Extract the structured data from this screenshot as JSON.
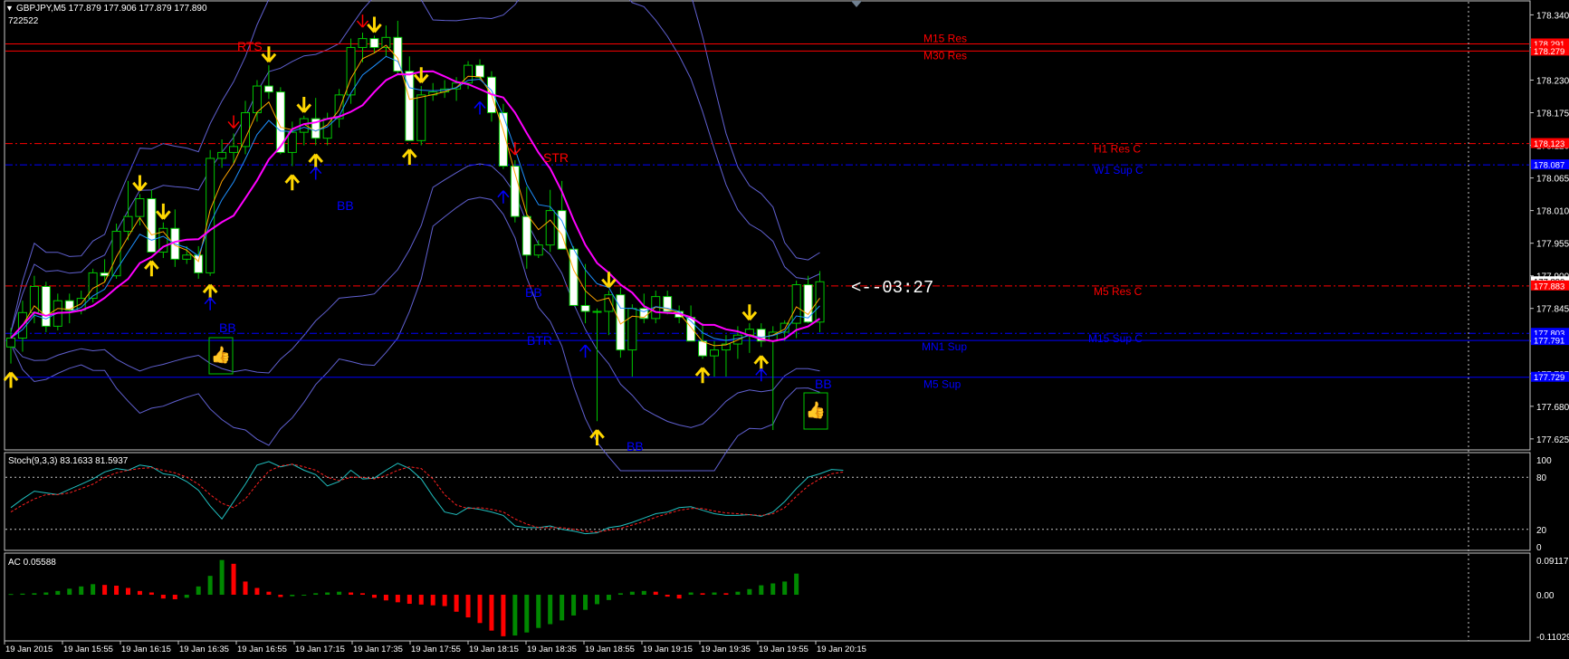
{
  "header": {
    "symbol_line": "GBPJPY,M5  177.879 177.906 177.879 177.890",
    "account": "722522"
  },
  "colors": {
    "background": "#000000",
    "bull_candle": "#00c800",
    "bear_candle_fill": "#ffffff",
    "ma_fast": "#ffa500",
    "ma_mid": "#1e90ff",
    "ma_slow": "#ff00ff",
    "bands": "#6060d0",
    "resistance": "#ff0000",
    "support": "#0000ff",
    "arrow_yellow": "#ffd700",
    "stoch_main": "#20c0c0",
    "stoch_signal": "#ff2020",
    "ac_up": "#008800",
    "ac_down": "#ff0000"
  },
  "price_axis": {
    "ticks": [
      "178.340",
      "178.285",
      "178.230",
      "178.175",
      "178.120",
      "178.065",
      "178.010",
      "177.955",
      "177.900",
      "177.845",
      "177.790",
      "177.735",
      "177.680",
      "177.625"
    ],
    "badges": [
      {
        "label": "178.291",
        "price": 178.291,
        "color": "#ff0000"
      },
      {
        "label": "178.279",
        "price": 178.279,
        "color": "#ff0000"
      },
      {
        "label": "178.123",
        "price": 178.123,
        "color": "#ff0000"
      },
      {
        "label": "178.087",
        "price": 178.087,
        "color": "#0000ff"
      },
      {
        "label": "177.890",
        "price": 177.89,
        "color": "#ffffff"
      },
      {
        "label": "177.883",
        "price": 177.883,
        "color": "#ff0000"
      },
      {
        "label": "177.803",
        "price": 177.803,
        "color": "#0000ff"
      },
      {
        "label": "177.791",
        "price": 177.791,
        "color": "#0000ff"
      },
      {
        "label": "177.729",
        "price": 177.729,
        "color": "#0000ff"
      }
    ],
    "range": [
      177.608,
      178.362
    ]
  },
  "levels": [
    {
      "label": "M15 Res",
      "price": 178.291,
      "color": "#ff0000",
      "style": "solid"
    },
    {
      "label": "M30 Res",
      "price": 178.279,
      "color": "#ff0000",
      "style": "solid"
    },
    {
      "label": "H1 Res C",
      "price": 178.123,
      "color": "#ff0000",
      "style": "dashdot"
    },
    {
      "label": "W1 Sup C",
      "price": 178.087,
      "color": "#0000ff",
      "style": "dashdot"
    },
    {
      "label": "M5 Res C",
      "price": 177.883,
      "color": "#ff0000",
      "style": "dashdot"
    },
    {
      "label": "M15 Sup C",
      "price": 177.803,
      "color": "#0000ff",
      "style": "dashdot"
    },
    {
      "label": "MN1 Sup",
      "price": 177.791,
      "color": "#0000ff",
      "style": "solid"
    },
    {
      "label": "M5 Sup",
      "price": 177.729,
      "color": "#0000ff",
      "style": "solid"
    }
  ],
  "annotations": [
    {
      "text": "RTS",
      "kind": "red"
    },
    {
      "text": "STR",
      "kind": "red"
    },
    {
      "text": "BB",
      "kind": "blue"
    },
    {
      "text": "BB",
      "kind": "blue"
    },
    {
      "text": "BB",
      "kind": "blue"
    },
    {
      "text": "BTR",
      "kind": "blue"
    },
    {
      "text": "BB",
      "kind": "blue"
    },
    {
      "text": "BB",
      "kind": "blue"
    }
  ],
  "countdown": "<--03:27",
  "stoch": {
    "label": "Stoch(9,3,3) 83.1633 81.5937",
    "ticks": [
      "100",
      "80",
      "20",
      "0"
    ],
    "main": [
      45,
      55,
      64,
      62,
      60,
      66,
      72,
      78,
      86,
      90,
      88,
      94,
      92,
      84,
      82,
      75,
      65,
      47,
      32,
      52,
      72,
      94,
      98,
      92,
      95,
      88,
      83,
      70,
      75,
      88,
      78,
      79,
      88,
      96,
      90,
      78,
      58,
      40,
      37,
      45,
      43,
      40,
      36,
      24,
      22,
      22,
      24,
      20,
      18,
      15,
      16,
      22,
      24,
      28,
      33,
      38,
      40,
      45,
      46,
      42,
      38,
      36,
      36,
      37,
      35,
      40,
      52,
      67,
      80,
      84,
      89,
      88
    ],
    "signal": [
      40,
      48,
      55,
      60,
      60,
      62,
      67,
      72,
      80,
      85,
      88,
      90,
      91,
      88,
      85,
      80,
      72,
      60,
      50,
      45,
      55,
      72,
      87,
      93,
      95,
      92,
      88,
      80,
      76,
      80,
      80,
      78,
      82,
      88,
      92,
      90,
      78,
      60,
      48,
      44,
      45,
      43,
      40,
      32,
      26,
      22,
      22,
      22,
      20,
      18,
      17,
      19,
      21,
      25,
      29,
      34,
      38,
      42,
      44,
      44,
      41,
      39,
      38,
      37,
      36,
      38,
      45,
      58,
      70,
      78,
      84,
      86
    ]
  },
  "ac": {
    "label": "AC 0.05588",
    "ticks": [
      "0.09117",
      "0.00",
      "-0.11029"
    ],
    "values": [
      0.002,
      0.003,
      0.004,
      0.006,
      0.01,
      0.016,
      0.022,
      0.028,
      0.026,
      0.024,
      0.018,
      0.01,
      0.006,
      -0.01,
      -0.012,
      -0.008,
      0.022,
      0.05,
      0.092,
      0.082,
      0.035,
      0.018,
      0.008,
      -0.006,
      -0.004,
      -0.002,
      0.004,
      0.006,
      0.008,
      0.006,
      0.004,
      -0.008,
      -0.015,
      -0.02,
      -0.024,
      -0.026,
      -0.028,
      -0.03,
      -0.045,
      -0.06,
      -0.075,
      -0.095,
      -0.11,
      -0.108,
      -0.1,
      -0.088,
      -0.078,
      -0.068,
      -0.055,
      -0.04,
      -0.025,
      -0.014,
      0.004,
      0.008,
      0.01,
      0.008,
      -0.005,
      -0.01,
      0.006,
      0.004,
      0.006,
      0.004,
      0.008,
      0.015,
      0.025,
      0.03,
      0.035,
      0.056
    ]
  },
  "candles": [
    {
      "o": 177.78,
      "h": 177.812,
      "l": 177.752,
      "c": 177.795
    },
    {
      "o": 177.795,
      "h": 177.858,
      "l": 177.772,
      "c": 177.838
    },
    {
      "o": 177.838,
      "h": 177.9,
      "l": 177.82,
      "c": 177.882
    },
    {
      "o": 177.882,
      "h": 177.89,
      "l": 177.805,
      "c": 177.815
    },
    {
      "o": 177.815,
      "h": 177.87,
      "l": 177.808,
      "c": 177.858
    },
    {
      "o": 177.858,
      "h": 177.87,
      "l": 177.82,
      "c": 177.842
    },
    {
      "o": 177.842,
      "h": 177.875,
      "l": 177.835,
      "c": 177.862
    },
    {
      "o": 177.862,
      "h": 177.912,
      "l": 177.855,
      "c": 177.905
    },
    {
      "o": 177.905,
      "h": 177.928,
      "l": 177.89,
      "c": 177.9
    },
    {
      "o": 177.9,
      "h": 177.988,
      "l": 177.895,
      "c": 177.975
    },
    {
      "o": 177.975,
      "h": 178.06,
      "l": 177.96,
      "c": 178.0
    },
    {
      "o": 178.0,
      "h": 178.038,
      "l": 177.985,
      "c": 178.03
    },
    {
      "o": 178.03,
      "h": 178.045,
      "l": 177.94,
      "c": 177.94
    },
    {
      "o": 177.94,
      "h": 177.99,
      "l": 177.93,
      "c": 177.98
    },
    {
      "o": 177.98,
      "h": 178.012,
      "l": 177.915,
      "c": 177.928
    },
    {
      "o": 177.928,
      "h": 177.95,
      "l": 177.92,
      "c": 177.935
    },
    {
      "o": 177.935,
      "h": 177.95,
      "l": 177.895,
      "c": 177.905
    },
    {
      "o": 177.905,
      "h": 178.112,
      "l": 177.9,
      "c": 178.098
    },
    {
      "o": 178.098,
      "h": 178.13,
      "l": 178.082,
      "c": 178.108
    },
    {
      "o": 178.108,
      "h": 178.14,
      "l": 178.09,
      "c": 178.118
    },
    {
      "o": 178.118,
      "h": 178.195,
      "l": 178.105,
      "c": 178.175
    },
    {
      "o": 178.175,
      "h": 178.23,
      "l": 178.16,
      "c": 178.22
    },
    {
      "o": 178.22,
      "h": 178.255,
      "l": 178.198,
      "c": 178.21
    },
    {
      "o": 178.21,
      "h": 178.218,
      "l": 178.105,
      "c": 178.108
    },
    {
      "o": 178.108,
      "h": 178.16,
      "l": 178.085,
      "c": 178.142
    },
    {
      "o": 178.142,
      "h": 178.17,
      "l": 178.12,
      "c": 178.165
    },
    {
      "o": 178.165,
      "h": 178.2,
      "l": 178.12,
      "c": 178.132
    },
    {
      "o": 178.132,
      "h": 178.175,
      "l": 178.12,
      "c": 178.165
    },
    {
      "o": 178.165,
      "h": 178.215,
      "l": 178.15,
      "c": 178.205
    },
    {
      "o": 178.205,
      "h": 178.3,
      "l": 178.19,
      "c": 178.285
    },
    {
      "o": 178.285,
      "h": 178.31,
      "l": 178.26,
      "c": 178.3
    },
    {
      "o": 178.3,
      "h": 178.305,
      "l": 178.275,
      "c": 178.285
    },
    {
      "o": 178.285,
      "h": 178.322,
      "l": 178.27,
      "c": 178.302
    },
    {
      "o": 178.302,
      "h": 178.33,
      "l": 178.24,
      "c": 178.245
    },
    {
      "o": 178.245,
      "h": 178.27,
      "l": 178.128,
      "c": 178.128
    },
    {
      "o": 178.128,
      "h": 178.22,
      "l": 178.12,
      "c": 178.205
    },
    {
      "o": 178.205,
      "h": 178.225,
      "l": 178.195,
      "c": 178.21
    },
    {
      "o": 178.21,
      "h": 178.23,
      "l": 178.2,
      "c": 178.215
    },
    {
      "o": 178.215,
      "h": 178.235,
      "l": 178.195,
      "c": 178.225
    },
    {
      "o": 178.225,
      "h": 178.262,
      "l": 178.215,
      "c": 178.255
    },
    {
      "o": 178.255,
      "h": 178.265,
      "l": 178.23,
      "c": 178.235
    },
    {
      "o": 178.235,
      "h": 178.245,
      "l": 178.16,
      "c": 178.175
    },
    {
      "o": 178.175,
      "h": 178.19,
      "l": 178.08,
      "c": 178.085
    },
    {
      "o": 178.085,
      "h": 178.095,
      "l": 177.99,
      "c": 178.0
    },
    {
      "o": 178.0,
      "h": 178.05,
      "l": 177.912,
      "c": 177.935
    },
    {
      "o": 177.935,
      "h": 177.96,
      "l": 177.93,
      "c": 177.952
    },
    {
      "o": 177.952,
      "h": 178.045,
      "l": 177.94,
      "c": 178.01
    },
    {
      "o": 178.01,
      "h": 178.06,
      "l": 177.945,
      "c": 177.945
    },
    {
      "o": 177.945,
      "h": 177.95,
      "l": 177.85,
      "c": 177.85
    },
    {
      "o": 177.85,
      "h": 177.92,
      "l": 177.82,
      "c": 177.84
    },
    {
      "o": 177.84,
      "h": 177.845,
      "l": 177.655,
      "c": 177.84
    },
    {
      "o": 177.84,
      "h": 177.875,
      "l": 177.8,
      "c": 177.868
    },
    {
      "o": 177.868,
      "h": 177.88,
      "l": 177.762,
      "c": 177.775
    },
    {
      "o": 177.775,
      "h": 177.852,
      "l": 177.73,
      "c": 177.845
    },
    {
      "o": 177.845,
      "h": 177.87,
      "l": 177.82,
      "c": 177.828
    },
    {
      "o": 177.828,
      "h": 177.875,
      "l": 177.82,
      "c": 177.865
    },
    {
      "o": 177.865,
      "h": 177.875,
      "l": 177.835,
      "c": 177.84
    },
    {
      "o": 177.84,
      "h": 177.85,
      "l": 177.82,
      "c": 177.83
    },
    {
      "o": 177.83,
      "h": 177.85,
      "l": 177.79,
      "c": 177.79
    },
    {
      "o": 177.79,
      "h": 177.82,
      "l": 177.76,
      "c": 177.765
    },
    {
      "o": 177.765,
      "h": 177.79,
      "l": 177.73,
      "c": 177.775
    },
    {
      "o": 177.775,
      "h": 177.8,
      "l": 177.73,
      "c": 177.785
    },
    {
      "o": 177.785,
      "h": 177.815,
      "l": 177.76,
      "c": 177.8
    },
    {
      "o": 177.8,
      "h": 177.82,
      "l": 177.77,
      "c": 177.81
    },
    {
      "o": 177.81,
      "h": 177.82,
      "l": 177.78,
      "c": 177.79
    },
    {
      "o": 177.79,
      "h": 177.815,
      "l": 177.64,
      "c": 177.805
    },
    {
      "o": 177.805,
      "h": 177.825,
      "l": 177.79,
      "c": 177.82
    },
    {
      "o": 177.82,
      "h": 177.892,
      "l": 177.795,
      "c": 177.885
    },
    {
      "o": 177.885,
      "h": 177.9,
      "l": 177.82,
      "c": 177.822
    },
    {
      "o": 177.822,
      "h": 177.908,
      "l": 177.805,
      "c": 177.89
    }
  ],
  "arrows": [
    {
      "i": 0,
      "type": "up",
      "color": "yellow"
    },
    {
      "i": 11,
      "type": "down",
      "color": "yellow"
    },
    {
      "i": 12,
      "type": "up",
      "color": "yellow"
    },
    {
      "i": 13,
      "type": "down",
      "color": "yellow"
    },
    {
      "i": 17,
      "type": "up",
      "color": "yellow"
    },
    {
      "i": 17,
      "type": "up",
      "color": "blue"
    },
    {
      "i": 19,
      "type": "down",
      "color": "red"
    },
    {
      "i": 22,
      "type": "down",
      "color": "yellow"
    },
    {
      "i": 24,
      "type": "up",
      "color": "yellow"
    },
    {
      "i": 25,
      "type": "down",
      "color": "yellow"
    },
    {
      "i": 26,
      "type": "up",
      "color": "yellow"
    },
    {
      "i": 26,
      "type": "up",
      "color": "blue"
    },
    {
      "i": 30,
      "type": "down",
      "color": "red"
    },
    {
      "i": 31,
      "type": "down",
      "color": "yellow"
    },
    {
      "i": 34,
      "type": "up",
      "color": "yellow"
    },
    {
      "i": 35,
      "type": "down",
      "color": "yellow"
    },
    {
      "i": 43,
      "type": "down",
      "color": "red"
    },
    {
      "i": 40,
      "type": "up",
      "color": "blue"
    },
    {
      "i": 42,
      "type": "up",
      "color": "blue"
    },
    {
      "i": 49,
      "type": "up",
      "color": "blue"
    },
    {
      "i": 50,
      "type": "up",
      "color": "yellow"
    },
    {
      "i": 51,
      "type": "down",
      "color": "yellow"
    },
    {
      "i": 59,
      "type": "up",
      "color": "yellow"
    },
    {
      "i": 63,
      "type": "down",
      "color": "yellow"
    },
    {
      "i": 64,
      "type": "up",
      "color": "yellow"
    },
    {
      "i": 64,
      "type": "up",
      "color": "blue"
    }
  ],
  "time_axis": [
    "19 Jan 2015",
    "19 Jan 15:55",
    "19 Jan 16:15",
    "19 Jan 16:35",
    "19 Jan 16:55",
    "19 Jan 17:15",
    "19 Jan 17:35",
    "19 Jan 17:55",
    "19 Jan 18:15",
    "19 Jan 18:35",
    "19 Jan 18:55",
    "19 Jan 19:15",
    "19 Jan 19:35",
    "19 Jan 19:55",
    "19 Jan 20:15"
  ]
}
